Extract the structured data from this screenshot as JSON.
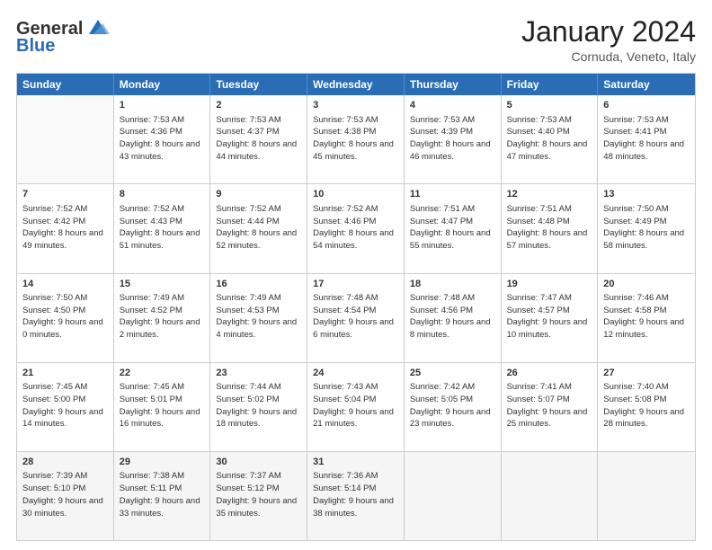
{
  "header": {
    "logo": {
      "general": "General",
      "blue": "Blue",
      "tagline": ""
    },
    "title": "January 2024",
    "subtitle": "Cornuda, Veneto, Italy"
  },
  "calendar": {
    "days": [
      "Sunday",
      "Monday",
      "Tuesday",
      "Wednesday",
      "Thursday",
      "Friday",
      "Saturday"
    ],
    "rows": [
      [
        {
          "day": "",
          "sunrise": "",
          "sunset": "",
          "daylight": "",
          "empty": true
        },
        {
          "day": "1",
          "sunrise": "Sunrise: 7:53 AM",
          "sunset": "Sunset: 4:36 PM",
          "daylight": "Daylight: 8 hours and 43 minutes."
        },
        {
          "day": "2",
          "sunrise": "Sunrise: 7:53 AM",
          "sunset": "Sunset: 4:37 PM",
          "daylight": "Daylight: 8 hours and 44 minutes."
        },
        {
          "day": "3",
          "sunrise": "Sunrise: 7:53 AM",
          "sunset": "Sunset: 4:38 PM",
          "daylight": "Daylight: 8 hours and 45 minutes."
        },
        {
          "day": "4",
          "sunrise": "Sunrise: 7:53 AM",
          "sunset": "Sunset: 4:39 PM",
          "daylight": "Daylight: 8 hours and 46 minutes."
        },
        {
          "day": "5",
          "sunrise": "Sunrise: 7:53 AM",
          "sunset": "Sunset: 4:40 PM",
          "daylight": "Daylight: 8 hours and 47 minutes."
        },
        {
          "day": "6",
          "sunrise": "Sunrise: 7:53 AM",
          "sunset": "Sunset: 4:41 PM",
          "daylight": "Daylight: 8 hours and 48 minutes."
        }
      ],
      [
        {
          "day": "7",
          "sunrise": "Sunrise: 7:52 AM",
          "sunset": "Sunset: 4:42 PM",
          "daylight": "Daylight: 8 hours and 49 minutes."
        },
        {
          "day": "8",
          "sunrise": "Sunrise: 7:52 AM",
          "sunset": "Sunset: 4:43 PM",
          "daylight": "Daylight: 8 hours and 51 minutes."
        },
        {
          "day": "9",
          "sunrise": "Sunrise: 7:52 AM",
          "sunset": "Sunset: 4:44 PM",
          "daylight": "Daylight: 8 hours and 52 minutes."
        },
        {
          "day": "10",
          "sunrise": "Sunrise: 7:52 AM",
          "sunset": "Sunset: 4:46 PM",
          "daylight": "Daylight: 8 hours and 54 minutes."
        },
        {
          "day": "11",
          "sunrise": "Sunrise: 7:51 AM",
          "sunset": "Sunset: 4:47 PM",
          "daylight": "Daylight: 8 hours and 55 minutes."
        },
        {
          "day": "12",
          "sunrise": "Sunrise: 7:51 AM",
          "sunset": "Sunset: 4:48 PM",
          "daylight": "Daylight: 8 hours and 57 minutes."
        },
        {
          "day": "13",
          "sunrise": "Sunrise: 7:50 AM",
          "sunset": "Sunset: 4:49 PM",
          "daylight": "Daylight: 8 hours and 58 minutes."
        }
      ],
      [
        {
          "day": "14",
          "sunrise": "Sunrise: 7:50 AM",
          "sunset": "Sunset: 4:50 PM",
          "daylight": "Daylight: 9 hours and 0 minutes."
        },
        {
          "day": "15",
          "sunrise": "Sunrise: 7:49 AM",
          "sunset": "Sunset: 4:52 PM",
          "daylight": "Daylight: 9 hours and 2 minutes."
        },
        {
          "day": "16",
          "sunrise": "Sunrise: 7:49 AM",
          "sunset": "Sunset: 4:53 PM",
          "daylight": "Daylight: 9 hours and 4 minutes."
        },
        {
          "day": "17",
          "sunrise": "Sunrise: 7:48 AM",
          "sunset": "Sunset: 4:54 PM",
          "daylight": "Daylight: 9 hours and 6 minutes."
        },
        {
          "day": "18",
          "sunrise": "Sunrise: 7:48 AM",
          "sunset": "Sunset: 4:56 PM",
          "daylight": "Daylight: 9 hours and 8 minutes."
        },
        {
          "day": "19",
          "sunrise": "Sunrise: 7:47 AM",
          "sunset": "Sunset: 4:57 PM",
          "daylight": "Daylight: 9 hours and 10 minutes."
        },
        {
          "day": "20",
          "sunrise": "Sunrise: 7:46 AM",
          "sunset": "Sunset: 4:58 PM",
          "daylight": "Daylight: 9 hours and 12 minutes."
        }
      ],
      [
        {
          "day": "21",
          "sunrise": "Sunrise: 7:45 AM",
          "sunset": "Sunset: 5:00 PM",
          "daylight": "Daylight: 9 hours and 14 minutes."
        },
        {
          "day": "22",
          "sunrise": "Sunrise: 7:45 AM",
          "sunset": "Sunset: 5:01 PM",
          "daylight": "Daylight: 9 hours and 16 minutes."
        },
        {
          "day": "23",
          "sunrise": "Sunrise: 7:44 AM",
          "sunset": "Sunset: 5:02 PM",
          "daylight": "Daylight: 9 hours and 18 minutes."
        },
        {
          "day": "24",
          "sunrise": "Sunrise: 7:43 AM",
          "sunset": "Sunset: 5:04 PM",
          "daylight": "Daylight: 9 hours and 21 minutes."
        },
        {
          "day": "25",
          "sunrise": "Sunrise: 7:42 AM",
          "sunset": "Sunset: 5:05 PM",
          "daylight": "Daylight: 9 hours and 23 minutes."
        },
        {
          "day": "26",
          "sunrise": "Sunrise: 7:41 AM",
          "sunset": "Sunset: 5:07 PM",
          "daylight": "Daylight: 9 hours and 25 minutes."
        },
        {
          "day": "27",
          "sunrise": "Sunrise: 7:40 AM",
          "sunset": "Sunset: 5:08 PM",
          "daylight": "Daylight: 9 hours and 28 minutes."
        }
      ],
      [
        {
          "day": "28",
          "sunrise": "Sunrise: 7:39 AM",
          "sunset": "Sunset: 5:10 PM",
          "daylight": "Daylight: 9 hours and 30 minutes."
        },
        {
          "day": "29",
          "sunrise": "Sunrise: 7:38 AM",
          "sunset": "Sunset: 5:11 PM",
          "daylight": "Daylight: 9 hours and 33 minutes."
        },
        {
          "day": "30",
          "sunrise": "Sunrise: 7:37 AM",
          "sunset": "Sunset: 5:12 PM",
          "daylight": "Daylight: 9 hours and 35 minutes."
        },
        {
          "day": "31",
          "sunrise": "Sunrise: 7:36 AM",
          "sunset": "Sunset: 5:14 PM",
          "daylight": "Daylight: 9 hours and 38 minutes."
        },
        {
          "day": "",
          "sunrise": "",
          "sunset": "",
          "daylight": "",
          "empty": true
        },
        {
          "day": "",
          "sunrise": "",
          "sunset": "",
          "daylight": "",
          "empty": true
        },
        {
          "day": "",
          "sunrise": "",
          "sunset": "",
          "daylight": "",
          "empty": true
        }
      ]
    ]
  }
}
